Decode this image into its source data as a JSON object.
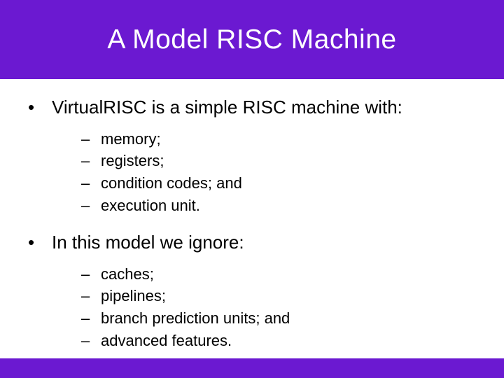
{
  "title": "A Model RISC Machine",
  "bullets": [
    {
      "text": "VirtualRISC is a simple RISC machine with:",
      "sub": [
        "memory;",
        "registers;",
        "condition codes; and",
        "execution unit."
      ]
    },
    {
      "text": "In this model we ignore:",
      "sub": [
        "caches;",
        "pipelines;",
        "branch prediction units; and",
        "advanced features."
      ]
    }
  ]
}
